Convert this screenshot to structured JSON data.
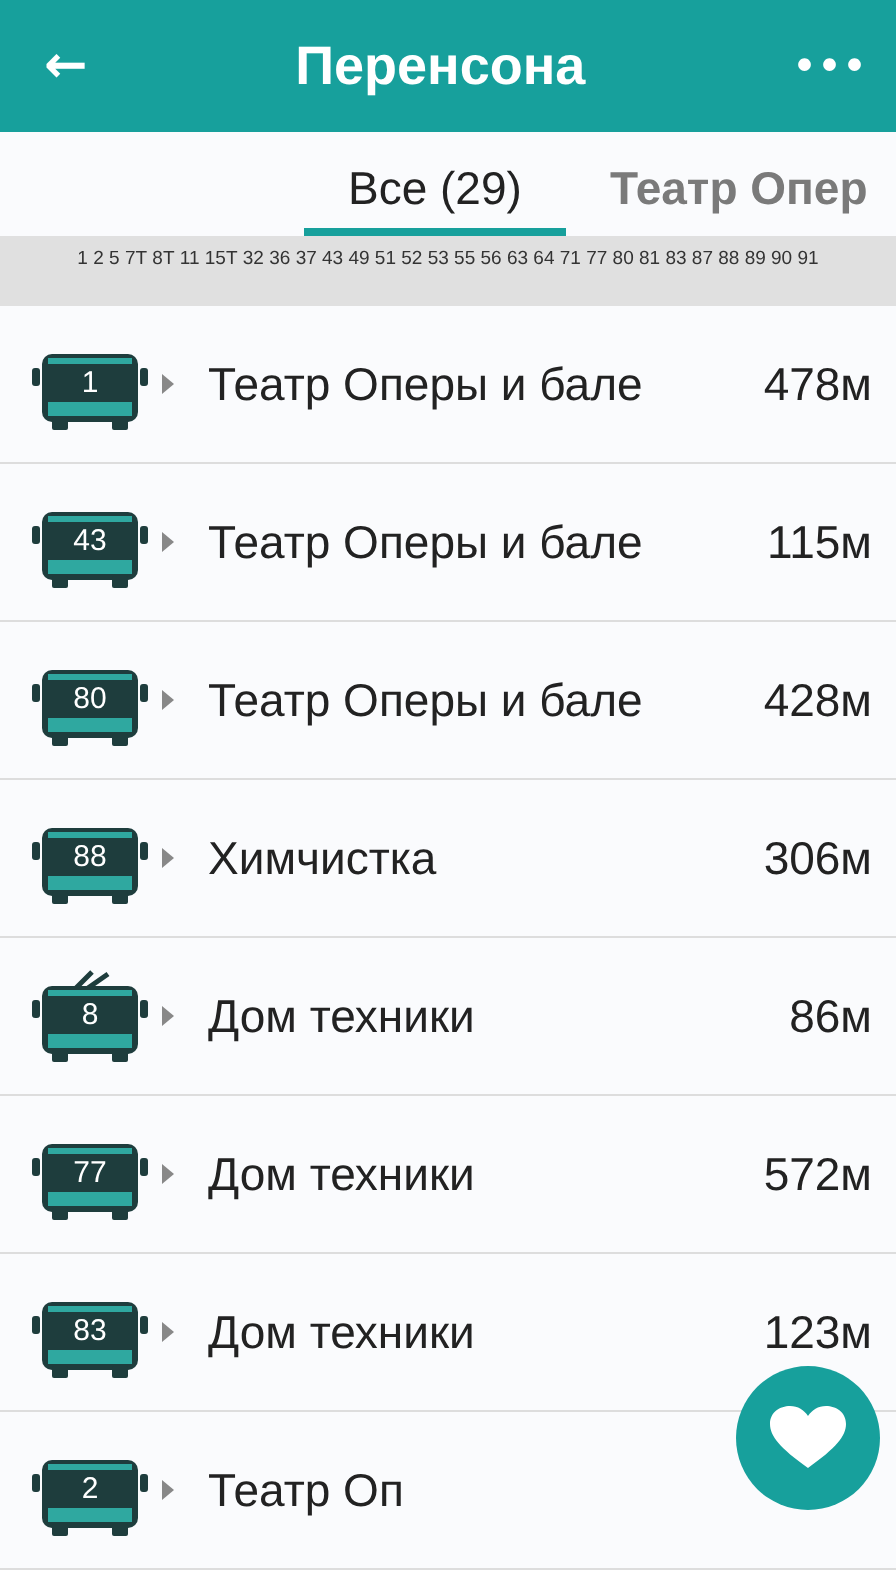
{
  "app_bar": {
    "back_icon": "←",
    "title": "Перенсона",
    "menu_icon": "•••"
  },
  "tabs": [
    {
      "label": "Все (29)",
      "selected": true
    },
    {
      "label": "Театр Опер",
      "selected": false
    }
  ],
  "routes_strip": "1 2 5 7Т 8Т 11 15Т 32 36 37 43 49 51 52 53 55 56 63 64 71 77 80 81 83 87 88 89 90 91",
  "stops": [
    {
      "kind": "bus",
      "route": "1",
      "name": "Театр Оперы и бале",
      "distance": "478м"
    },
    {
      "kind": "bus",
      "route": "43",
      "name": "Театр Оперы и бале",
      "distance": "115м"
    },
    {
      "kind": "bus",
      "route": "80",
      "name": "Театр Оперы и бале",
      "distance": "428м"
    },
    {
      "kind": "bus",
      "route": "88",
      "name": "Химчистка",
      "distance": "306м"
    },
    {
      "kind": "trolleybus",
      "route": "8",
      "name": "Дом техники",
      "distance": "86м"
    },
    {
      "kind": "bus",
      "route": "77",
      "name": "Дом техники",
      "distance": "572м"
    },
    {
      "kind": "bus",
      "route": "83",
      "name": "Дом техники",
      "distance": "123м"
    },
    {
      "kind": "bus",
      "route": "2",
      "name": "Театр Оп"
    }
  ]
}
